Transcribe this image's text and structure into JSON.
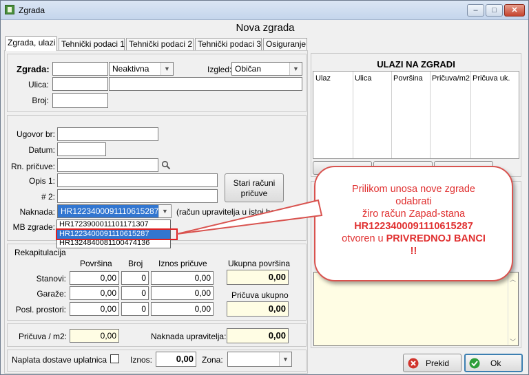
{
  "window": {
    "title": "Zgrada",
    "minimize": "–",
    "maximize": "□",
    "close": "✕"
  },
  "form_title": "Nova zgrada",
  "tabs": [
    "Zgrada, ulazi",
    "Tehnički podaci 1",
    "Tehnički podaci 2",
    "Tehnički podaci 3",
    "Osiguranje"
  ],
  "zgrada": {
    "label": "Zgrada:",
    "value": "",
    "status": "Neaktivna",
    "izgled_label": "Izgled:",
    "izgled": "Običan",
    "ulica_label": "Ulica:",
    "ulica": "",
    "ulica2": "",
    "broj_label": "Broj:",
    "broj": ""
  },
  "ugovor": {
    "ugovor_label": "Ugovor br:",
    "datum_label": "Datum:",
    "rn_label": "Rn. pričuve:",
    "opis1_label": "Opis 1:",
    "opis2_label": "# 2:",
    "stari_btn": "Stari računi pričuve",
    "naknada_label": "Naknada:",
    "naknada_value": "HR1223400091110615287",
    "naknada_note": "(račun upravitelja u istoj banci)",
    "mb_label": "MB zgrade:",
    "dropdown_options": [
      "HR1723900011101171307",
      "HR1223400091110615287",
      "HR1324840081100474136"
    ],
    "dropdown_selected": 1
  },
  "rekap": {
    "title": "Rekapitulacija",
    "col_povrsina": "Površina",
    "col_broj": "Broj",
    "col_iznos": "Iznos pričuve",
    "ukupna_label": "Ukupna površina",
    "ukupna_value": "0,00",
    "pricuva_ukupno_label": "Pričuva ukupno",
    "pricuva_ukupno_value": "0,00",
    "rows": [
      {
        "label": "Stanovi:",
        "povrsina": "0,00",
        "broj": "0",
        "iznos": "0,00"
      },
      {
        "label": "Garaže:",
        "povrsina": "0,00",
        "broj": "0",
        "iznos": "0,00"
      },
      {
        "label": "Posl. prostori:",
        "povrsina": "0,00",
        "broj": "0",
        "iznos": "0,00"
      }
    ]
  },
  "pricuva": {
    "label": "Pričuva / m2:",
    "value": "0,00",
    "naknada_label": "Naknada upravitelja:",
    "naknada_value": "0,00"
  },
  "bottom": {
    "naplata_label": "Naplata dostave uplatnica",
    "iznos_label": "Iznos:",
    "iznos_value": "0,00",
    "zona_label": "Zona:"
  },
  "ulazi": {
    "title": "ULAZI NA ZGRADI",
    "columns": [
      "Ulaz",
      "Ulica",
      "Površina",
      "Pričuva/m2",
      "Pričuva uk."
    ]
  },
  "callout": {
    "line1": "Prilikom unosa nove zgrade",
    "line2": "odabrati",
    "line3": "žiro račun Zapad-stana",
    "line4": "HR1223400091110615287",
    "line5a": "otvoren u ",
    "line5b": "PRIVREDNOJ BANCI",
    "line6": "!!"
  },
  "buttons": {
    "prekid": "Prekid",
    "ok": "Ok"
  },
  "colors": {
    "highlight_border": "#e02020",
    "callout_text": "#e03030",
    "selection": "#3276d0",
    "yellow_field": "#fffde4"
  }
}
